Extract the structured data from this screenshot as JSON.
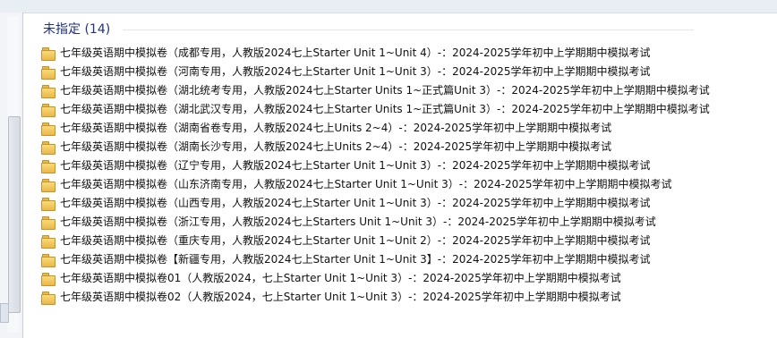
{
  "group": {
    "title": "未指定 (14)"
  },
  "items": [
    {
      "name": "七年级英语期中模拟卷（成都专用，人教版2024七上Starter Unit 1~Unit 4）-：2024-2025学年初中上学期期中模拟考试",
      "icon": "folder-icon"
    },
    {
      "name": "七年级英语期中模拟卷（河南专用，人教版2024七上Starter Unit 1~Unit 3）-：2024-2025学年初中上学期期中模拟考试",
      "icon": "folder-icon"
    },
    {
      "name": "七年级英语期中模拟卷（湖北统考专用，人教版2024七上Starter Units 1~正式篇Unit 3）-：2024-2025学年初中上学期期中模拟考试",
      "icon": "folder-icon"
    },
    {
      "name": "七年级英语期中模拟卷（湖北武汉专用，人教版2024七上Starter Units 1~正式篇Unit 3）-：2024-2025学年初中上学期期中模拟考试",
      "icon": "folder-icon"
    },
    {
      "name": "七年级英语期中模拟卷（湖南省卷专用，人教版2024七上Units 2~4）-：2024-2025学年初中上学期期中模拟考试",
      "icon": "folder-icon"
    },
    {
      "name": "七年级英语期中模拟卷（湖南长沙专用，人教版2024七上Units 2~4）-：2024-2025学年初中上学期期中模拟考试",
      "icon": "folder-icon"
    },
    {
      "name": "七年级英语期中模拟卷（辽宁专用，人教版2024七上Starter Unit 1~Unit 3）-：2024-2025学年初中上学期期中模拟考试",
      "icon": "folder-icon"
    },
    {
      "name": "七年级英语期中模拟卷（山东济南专用，人教版2024七上Starter Unit 1~Unit 3）-：2024-2025学年初中上学期期中模拟考试",
      "icon": "folder-icon"
    },
    {
      "name": "七年级英语期中模拟卷（山西专用，人教版2024七上Starter Unit 1~Unit 3）-：2024-2025学年初中上学期期中模拟考试",
      "icon": "folder-icon"
    },
    {
      "name": "七年级英语期中模拟卷（浙江专用，人教版2024七上Starters Unit 1~Unit 3）-：2024-2025学年初中上学期期中模拟考试",
      "icon": "folder-icon"
    },
    {
      "name": "七年级英语期中模拟卷（重庆专用，人教版2024七上Starter Unit 1~Unit 2）-：2024-2025学年初中上学期期中模拟考试",
      "icon": "folder-icon"
    },
    {
      "name": "七年级英语期中模拟卷【新疆专用，人教版2024七上Starter Unit 1~Unit 3】-：2024-2025学年初中上学期期中模拟考试",
      "icon": "folder-icon"
    },
    {
      "name": "七年级英语期中模拟卷01（人教版2024，七上Starter Unit 1~Unit 3）-：2024-2025学年初中上学期期中模拟考试",
      "icon": "folder-icon"
    },
    {
      "name": "七年级英语期中模拟卷02（人教版2024，七上Starter Unit 1~Unit 3）-：2024-2025学年初中上学期期中模拟考试",
      "icon": "folder-icon"
    }
  ]
}
